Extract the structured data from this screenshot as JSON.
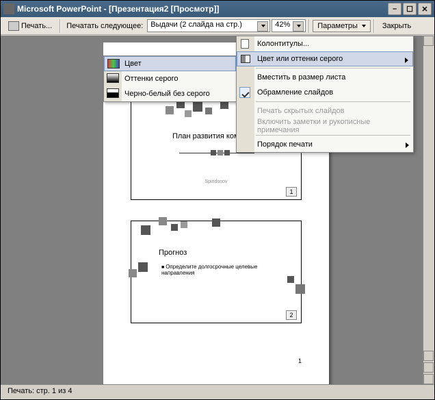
{
  "titlebar": {
    "app": "Microsoft PowerPoint",
    "doc": "[Презентация2 [Просмотр]]"
  },
  "toolbar": {
    "print": "Печать...",
    "print_next_label": "Печатать следующее:",
    "print_next_value": "Выдачи (2 слайда на стр.)",
    "zoom": "42%",
    "params": "Параметры",
    "close": "Закрыть"
  },
  "color_submenu": {
    "items": [
      "Цвет",
      "Оттенки серого",
      "Черно-белый без серого"
    ],
    "selected_index": 0
  },
  "params_menu": {
    "items": [
      {
        "label": "Колонтитулы...",
        "icon": "file"
      },
      {
        "label": "Цвет или оттенки серого",
        "icon": "color",
        "submenu": true,
        "selected": true
      },
      {
        "sep": true
      },
      {
        "label": "Вместить в размер листа"
      },
      {
        "label": "Обрамление слайдов",
        "checked": true
      },
      {
        "sep": true
      },
      {
        "label": "Печать скрытых слайдов",
        "disabled": true
      },
      {
        "label": "Включить заметки и рукописные примечания",
        "disabled": true
      },
      {
        "sep": true
      },
      {
        "label": "Порядок печати",
        "submenu": true
      }
    ]
  },
  "page": {
    "slide1": {
      "title": "План развития ком",
      "footer": "Spiridonov",
      "num": "1"
    },
    "slide2": {
      "title": "Прогноз",
      "body": "Определите долгосрочные целевые направления",
      "num": "2"
    },
    "footer_page": "1"
  },
  "statusbar": {
    "text": "Печать: стр. 1 из 4"
  }
}
